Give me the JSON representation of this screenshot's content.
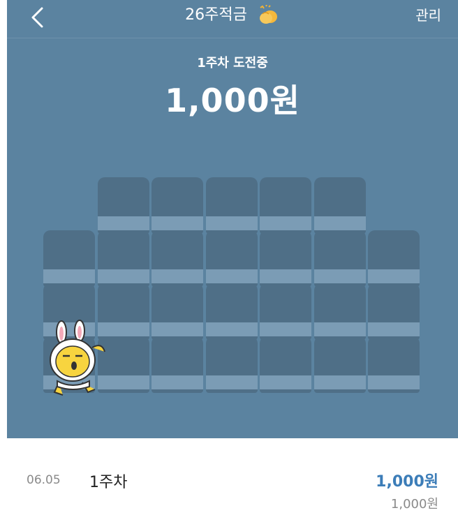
{
  "header": {
    "title": "26주적금",
    "manage_label": "관리",
    "back_icon": "chevron-left-icon",
    "title_emoji_icon": "clapping-hands-icon"
  },
  "challenge": {
    "status_label": "1주차 도전중",
    "amount": "1,000원"
  },
  "grid": {
    "completed_weeks": 1,
    "total_weeks": 26
  },
  "history": [
    {
      "date": "06.05",
      "week": "1주차",
      "amount": "1,000원",
      "balance": "1,000원"
    }
  ],
  "colors": {
    "hero_bg": "#5b83a0",
    "seat_back": "#4f6f87",
    "seat_cushion": "#7b9cb5",
    "amount_accent": "#3c7db8"
  }
}
